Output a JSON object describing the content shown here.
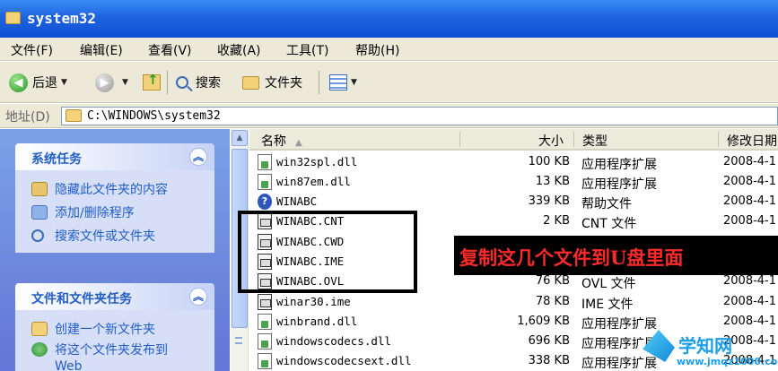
{
  "window": {
    "title": "system32"
  },
  "menu": [
    "文件(F)",
    "编辑(E)",
    "查看(V)",
    "收藏(A)",
    "工具(T)",
    "帮助(H)"
  ],
  "toolbar": {
    "back": "后退",
    "search": "搜索",
    "folders": "文件夹"
  },
  "address": {
    "label": "地址(D)",
    "value": "C:\\WINDOWS\\system32"
  },
  "tasks": {
    "system_title": "系统任务",
    "system_items": [
      "隐藏此文件夹的内容",
      "添加/删除程序",
      "搜索文件或文件夹"
    ],
    "file_title": "文件和文件夹任务",
    "file_items": [
      "创建一个新文件夹",
      "将这个文件夹发布到",
      "Web"
    ]
  },
  "columns": {
    "name": "名称",
    "size": "大小",
    "type": "类型",
    "date": "修改日期"
  },
  "files": [
    {
      "name": "win32spl.dll",
      "size": "100 KB",
      "type": "应用程序扩展",
      "date": "2008-4-1",
      "icon": "dll-icon"
    },
    {
      "name": "win87em.dll",
      "size": "13 KB",
      "type": "应用程序扩展",
      "date": "2008-4-1",
      "icon": "dll-icon"
    },
    {
      "name": "WINABC",
      "size": "339 KB",
      "type": "帮助文件",
      "date": "2008-4-1",
      "icon": "help-file-icon"
    },
    {
      "name": "WINABC.CNT",
      "size": "2 KB",
      "type": "CNT 文件",
      "date": "2008-4-1",
      "icon": "generic-file-icon"
    },
    {
      "name": "WINABC.CWD",
      "size": "",
      "type": "",
      "date": "",
      "icon": "generic-file-icon"
    },
    {
      "name": "WINABC.IME",
      "size": "",
      "type": "",
      "date": "",
      "icon": "generic-file-icon"
    },
    {
      "name": "WINABC.OVL",
      "size": "76 KB",
      "type": "OVL 文件",
      "date": "2008-4-1",
      "icon": "generic-file-icon"
    },
    {
      "name": "winar30.ime",
      "size": "78 KB",
      "type": "IME 文件",
      "date": "2008-4-1",
      "icon": "generic-file-icon"
    },
    {
      "name": "winbrand.dll",
      "size": "1,609 KB",
      "type": "应用程序扩展",
      "date": "2008-4-1",
      "icon": "dll-icon"
    },
    {
      "name": "windowscodecs.dll",
      "size": "696 KB",
      "type": "应用程序扩展",
      "date": "2008-4-1",
      "icon": "dll-icon"
    },
    {
      "name": "windowscodecsext.dll",
      "size": "338 KB",
      "type": "应用程序扩展",
      "date": "2008-4-1",
      "icon": "dll-icon"
    }
  ],
  "annotation": {
    "text": "复制这几个文件到U盘里面"
  },
  "watermark": {
    "brand": "学知网",
    "url": "www.jmqz1000.com"
  },
  "colors": {
    "annotation_text": "#ff2a2a",
    "task_link": "#215dc6",
    "title_bar": "#1f63e0"
  }
}
